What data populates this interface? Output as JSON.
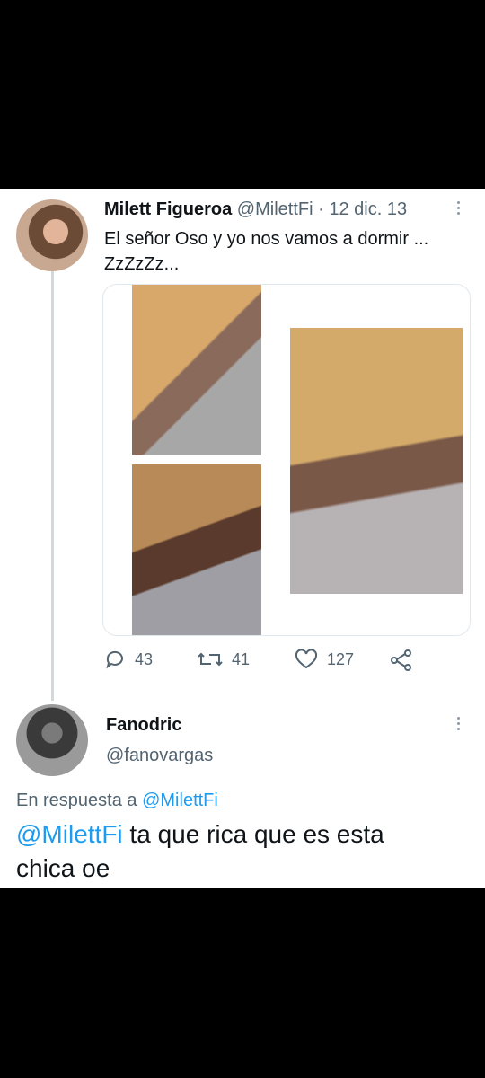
{
  "tweet": {
    "author_name": "Milett Figueroa",
    "author_handle": "@MilettFi",
    "separator": "·",
    "date": "12 dic. 13",
    "text_line1": "El señor Oso y yo nos vamos a dormir ...",
    "text_line2": "ZzZzZz...",
    "metrics": {
      "replies": "43",
      "retweets": "41",
      "likes": "127"
    }
  },
  "reply": {
    "author_name": "Fanodric",
    "author_handle": "@fanovargas",
    "in_reply_prefix": "En respuesta a",
    "in_reply_handle": "@MilettFi",
    "mention": "@MilettFi",
    "text_line1": " ta que rica que es esta",
    "text_line2": "chica oe"
  },
  "colors": {
    "link": "#1d9bf0",
    "muted": "#536471",
    "divider": "#cfd9de"
  },
  "icons": [
    "reply-icon",
    "retweet-icon",
    "like-icon",
    "share-icon",
    "more-icon"
  ]
}
